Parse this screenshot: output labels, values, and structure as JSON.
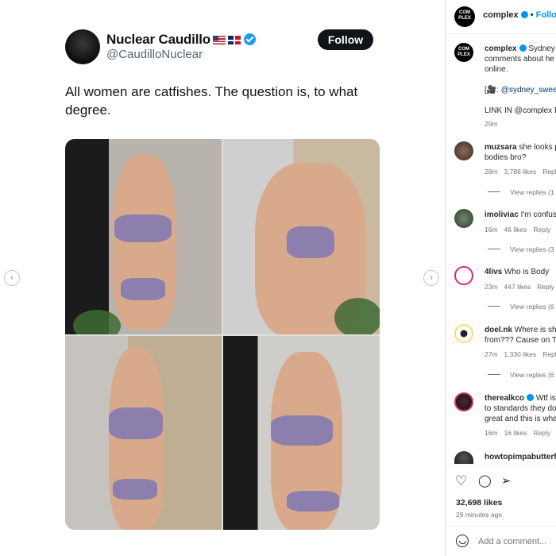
{
  "tweet": {
    "name": "Nuclear Caudillo",
    "handle": "@CaudilloNuclear",
    "follow_label": "Follow",
    "text": "All women are catfishes. The question is, to what degree."
  },
  "carousel": {
    "prev_icon": "chevron-left-icon",
    "next_icon": "chevron-right-icon",
    "prev_glyph": "‹",
    "next_glyph": "›"
  },
  "post_header": {
    "username": "complex",
    "separator": "•",
    "follow_label": "Follow",
    "avatar_text": "COM PLEX"
  },
  "caption": {
    "username": "complex",
    "line1": "Sydney S",
    "line2": "comments about he",
    "line3": "online.",
    "mention": "[🎥: @sydney_swee",
    "link_line": "LINK IN @complex E",
    "time": "29m"
  },
  "comments": [
    {
      "username": "muzsara",
      "line1": "she looks p",
      "line2": "bodies bro?",
      "time": "28m",
      "likes": "3,788 likes",
      "reply": "Repl",
      "view_replies": "View replies (1"
    },
    {
      "username": "imoliviac",
      "line1": "I'm confus",
      "line2": "",
      "time": "16m",
      "likes": "46 likes",
      "reply": "Reply",
      "view_replies": "View replies (3"
    },
    {
      "username": "4livs",
      "line1": "Who is Body",
      "line2": "",
      "time": "23m",
      "likes": "447 likes",
      "reply": "Reply",
      "view_replies": "View replies (6"
    },
    {
      "username": "doel.nk",
      "line1": "Where is she",
      "line2": "from??? Cause on Tw",
      "time": "27m",
      "likes": "1,330 likes",
      "reply": "Repl",
      "view_replies": "View replies (6"
    },
    {
      "username": "therealkco",
      "line1": "Wtf is",
      "line2": "to standards they do",
      "line3": "great and this is wha",
      "time": "16m",
      "likes": "16 likes",
      "reply": "Reply",
      "view_replies": ""
    },
    {
      "username": "howtopimpabutterf",
      "line1": "",
      "line2": "",
      "time": "",
      "likes": "",
      "reply": "",
      "view_replies": ""
    }
  ],
  "actions": {
    "like_icon": "heart-icon",
    "comment_icon": "comment-icon",
    "share_icon": "share-icon",
    "like_glyph": "♡",
    "comment_glyph": "◯",
    "share_glyph": "➢"
  },
  "stats": {
    "likes": "32,698 likes",
    "time_ago": "29 minutes ago"
  },
  "composer": {
    "placeholder": "Add a comment..."
  },
  "colors": {
    "accent": "#0095f6",
    "twitter_blue": "#1d9bf0",
    "text_dark": "#262626",
    "muted": "#737373"
  }
}
